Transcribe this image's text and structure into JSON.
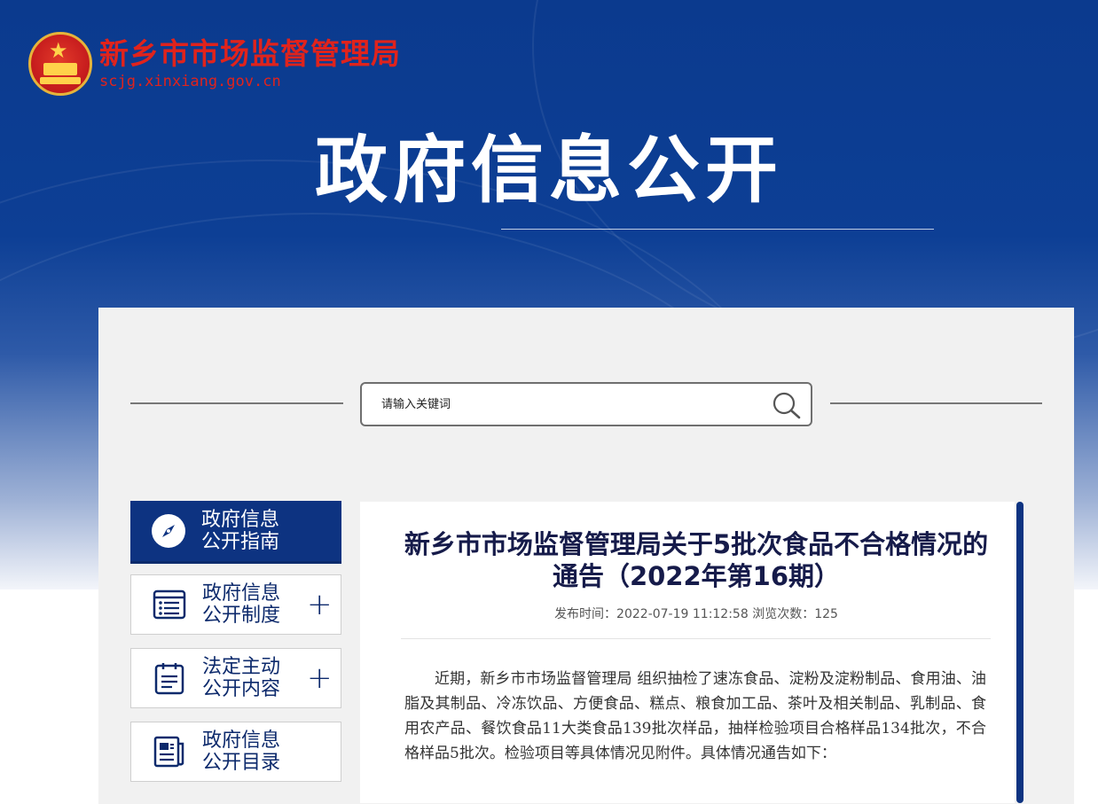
{
  "header": {
    "site_title": "新乡市市场监督管理局",
    "site_url": "scjg.xinxiang.gov.cn",
    "hero_title": "政府信息公开"
  },
  "search": {
    "placeholder": "请输入关键词",
    "icon": "search-icon"
  },
  "sidebar": {
    "items": [
      {
        "label": "政府信息公开指南",
        "line1": "政府信息",
        "line2": "公开指南",
        "icon": "compass-icon",
        "active": true
      },
      {
        "label": "政府信息公开制度",
        "line1": "政府信息",
        "line2": "公开制度",
        "icon": "list-icon",
        "expand": "+"
      },
      {
        "label": "法定主动公开内容",
        "line1": "法定主动",
        "line2": "公开内容",
        "icon": "clipboard-icon",
        "expand": "+"
      },
      {
        "label": "政府信息公开目录",
        "line1": "政府信息",
        "line2": "公开目录",
        "icon": "newspaper-icon"
      }
    ]
  },
  "article": {
    "title": "新乡市市场监督管理局关于5批次食品不合格情况的通告（2022年第16期）",
    "meta": "发布时间：2022-07-19 11:12:58  浏览次数：125",
    "body": "近期，新乡市市场监督管理局 组织抽检了速冻食品、淀粉及淀粉制品、食用油、油脂及其制品、冷冻饮品、方便食品、糕点、粮食加工品、茶叶及相关制品、乳制品、食用农产品、餐饮食品11大类食品139批次样品，抽样检验项目合格样品134批次，不合格样品5批次。检验项目等具体情况见附件。具体情况通告如下："
  },
  "colors": {
    "brand_blue": "#0d3381",
    "brand_red": "#e0231c",
    "panel_bg": "#f1f1f1"
  }
}
